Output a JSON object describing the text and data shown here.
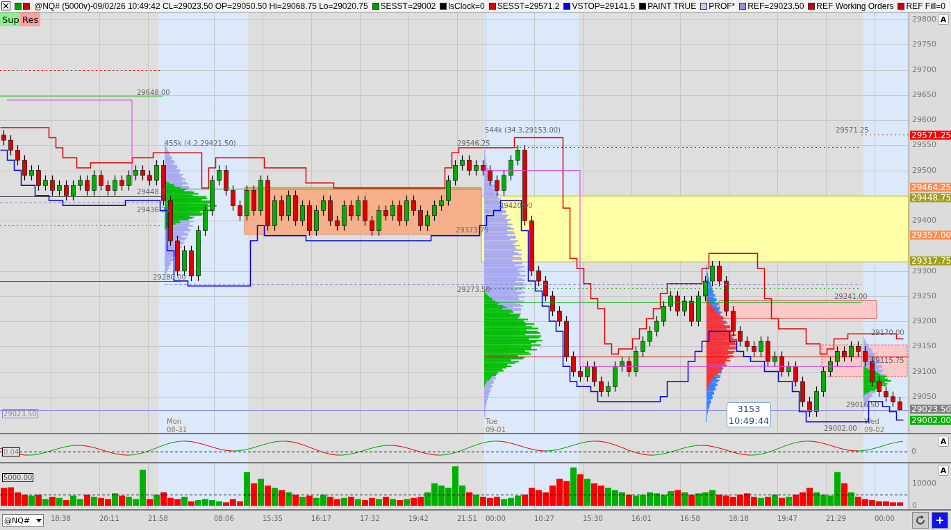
{
  "header": {
    "title": "@NQ# (5000v)-09/02/26 10:49:42 CL=29023.50 OP=29050.50 Hi=29068.75 Lo=29020.75",
    "legend": [
      {
        "text": "SESST=29002",
        "color": "#00a000"
      },
      {
        "text": "lsClock=0",
        "color": "#000000"
      },
      {
        "text": "SESST=29571.2",
        "color": "#e00000"
      },
      {
        "text": "VSTOP=29141.5",
        "color": "#0000e0"
      },
      {
        "text": "PAINT TRUE",
        "color": "#000000"
      },
      {
        "text": "PROF*",
        "color": "#c8c8f0"
      },
      {
        "text": "REF=29023.50",
        "color": "#9090e0"
      },
      {
        "text": "REF Working Orders",
        "color": "#d00000"
      },
      {
        "text": "REF Fill=0",
        "color": "#d00000"
      }
    ]
  },
  "buttons": [
    {
      "label": "Sup",
      "kind": "support"
    },
    {
      "label": "Res",
      "kind": "resistance"
    }
  ],
  "price_chart": {
    "autoscale": "A",
    "chart_data": {
      "type": "candlestick",
      "grid": true,
      "ylim": [
        28978,
        29814
      ],
      "yticks": [
        29050,
        29100,
        29150,
        29200,
        29250,
        29300,
        29400,
        29500,
        29550,
        29600,
        29650,
        29700,
        29750,
        29800
      ],
      "ohlc": [
        [
          29570,
          29580,
          29550,
          29560
        ],
        [
          29560,
          29570,
          29530,
          29540
        ],
        [
          29540,
          29550,
          29510,
          29520
        ],
        [
          29520,
          29530,
          29480,
          29490
        ],
        [
          29490,
          29510,
          29480,
          29500
        ],
        [
          29500,
          29510,
          29460,
          29470
        ],
        [
          29470,
          29490,
          29460,
          29480
        ],
        [
          29480,
          29490,
          29450,
          29460
        ],
        [
          29460,
          29480,
          29450,
          29470
        ],
        [
          29470,
          29480,
          29440,
          29450
        ],
        [
          29450,
          29480,
          29440,
          29470
        ],
        [
          29470,
          29490,
          29460,
          29480
        ],
        [
          29480,
          29490,
          29450,
          29460
        ],
        [
          29460,
          29500,
          29450,
          29490
        ],
        [
          29490,
          29500,
          29460,
          29470
        ],
        [
          29470,
          29480,
          29450,
          29460
        ],
        [
          29460,
          29490,
          29450,
          29480
        ],
        [
          29480,
          29490,
          29460,
          29470
        ],
        [
          29470,
          29500,
          29460,
          29490
        ],
        [
          29490,
          29510,
          29480,
          29500
        ],
        [
          29500,
          29510,
          29480,
          29490
        ],
        [
          29490,
          29500,
          29470,
          29480
        ],
        [
          29480,
          29520,
          29470,
          29510
        ],
        [
          29510,
          29520,
          29430,
          29440
        ],
        [
          29440,
          29450,
          29350,
          29360
        ],
        [
          29360,
          29370,
          29290,
          29300
        ],
        [
          29300,
          29350,
          29290,
          29340
        ],
        [
          29340,
          29350,
          29280,
          29290
        ],
        [
          29290,
          29390,
          29280,
          29380
        ],
        [
          29380,
          29430,
          29370,
          29420
        ],
        [
          29420,
          29490,
          29410,
          29480
        ],
        [
          29480,
          29510,
          29470,
          29500
        ],
        [
          29500,
          29510,
          29450,
          29460
        ],
        [
          29460,
          29470,
          29420,
          29430
        ],
        [
          29430,
          29440,
          29400,
          29410
        ],
        [
          29410,
          29470,
          29400,
          29460
        ],
        [
          29460,
          29470,
          29410,
          29420
        ],
        [
          29420,
          29490,
          29410,
          29480
        ],
        [
          29480,
          29490,
          29380,
          29390
        ],
        [
          29390,
          29450,
          29380,
          29440
        ],
        [
          29440,
          29450,
          29400,
          29410
        ],
        [
          29410,
          29460,
          29400,
          29450
        ],
        [
          29450,
          29460,
          29390,
          29400
        ],
        [
          29400,
          29440,
          29390,
          29430
        ],
        [
          29430,
          29440,
          29370,
          29380
        ],
        [
          29380,
          29430,
          29370,
          29420
        ],
        [
          29420,
          29450,
          29410,
          29440
        ],
        [
          29440,
          29450,
          29390,
          29400
        ],
        [
          29400,
          29410,
          29380,
          29390
        ],
        [
          29390,
          29440,
          29380,
          29430
        ],
        [
          29430,
          29440,
          29400,
          29410
        ],
        [
          29410,
          29450,
          29400,
          29440
        ],
        [
          29440,
          29450,
          29390,
          29400
        ],
        [
          29400,
          29410,
          29370,
          29380
        ],
        [
          29380,
          29430,
          29370,
          29420
        ],
        [
          29420,
          29430,
          29400,
          29410
        ],
        [
          29410,
          29440,
          29400,
          29430
        ],
        [
          29430,
          29440,
          29390,
          29400
        ],
        [
          29400,
          29450,
          29390,
          29440
        ],
        [
          29440,
          29450,
          29410,
          29420
        ],
        [
          29420,
          29430,
          29380,
          29390
        ],
        [
          29390,
          29420,
          29380,
          29410
        ],
        [
          29410,
          29440,
          29400,
          29430
        ],
        [
          29430,
          29450,
          29420,
          29440
        ],
        [
          29440,
          29490,
          29430,
          29480
        ],
        [
          29480,
          29520,
          29470,
          29510
        ],
        [
          29510,
          29530,
          29500,
          29520
        ],
        [
          29520,
          29530,
          29490,
          29500
        ],
        [
          29500,
          29520,
          29490,
          29510
        ],
        [
          29510,
          29520,
          29490,
          29500
        ],
        [
          29500,
          29510,
          29470,
          29480
        ],
        [
          29480,
          29490,
          29450,
          29460
        ],
        [
          29460,
          29500,
          29450,
          29490
        ],
        [
          29490,
          29530,
          29480,
          29520
        ],
        [
          29520,
          29550,
          29510,
          29540
        ],
        [
          29540,
          29550,
          29390,
          29400
        ],
        [
          29400,
          29410,
          29290,
          29300
        ],
        [
          29300,
          29310,
          29270,
          29280
        ],
        [
          29280,
          29290,
          29240,
          29250
        ],
        [
          29250,
          29260,
          29210,
          29220
        ],
        [
          29220,
          29230,
          29190,
          29200
        ],
        [
          29200,
          29210,
          29120,
          29130
        ],
        [
          29130,
          29140,
          29090,
          29100
        ],
        [
          29100,
          29110,
          29080,
          29090
        ],
        [
          29090,
          29120,
          29080,
          29110
        ],
        [
          29110,
          29120,
          29070,
          29080
        ],
        [
          29080,
          29090,
          29050,
          29060
        ],
        [
          29060,
          29080,
          29050,
          29070
        ],
        [
          29070,
          29120,
          29060,
          29110
        ],
        [
          29110,
          29130,
          29100,
          29120
        ],
        [
          29120,
          29130,
          29090,
          29100
        ],
        [
          29100,
          29150,
          29090,
          29140
        ],
        [
          29140,
          29170,
          29130,
          29160
        ],
        [
          29160,
          29190,
          29150,
          29180
        ],
        [
          29180,
          29210,
          29170,
          29200
        ],
        [
          29200,
          29240,
          29190,
          29230
        ],
        [
          29230,
          29260,
          29220,
          29250
        ],
        [
          29250,
          29260,
          29210,
          29220
        ],
        [
          29220,
          29250,
          29210,
          29240
        ],
        [
          29240,
          29250,
          29190,
          29200
        ],
        [
          29200,
          29260,
          29190,
          29250
        ],
        [
          29250,
          29290,
          29240,
          29280
        ],
        [
          29280,
          29320,
          29270,
          29310
        ],
        [
          29310,
          29320,
          29270,
          29280
        ],
        [
          29280,
          29290,
          29210,
          29220
        ],
        [
          29220,
          29230,
          29170,
          29180
        ],
        [
          29180,
          29190,
          29150,
          29160
        ],
        [
          29160,
          29170,
          29140,
          29150
        ],
        [
          29150,
          29160,
          29130,
          29140
        ],
        [
          29140,
          29170,
          29130,
          29160
        ],
        [
          29160,
          29170,
          29110,
          29120
        ],
        [
          29120,
          29140,
          29110,
          29130
        ],
        [
          29130,
          29140,
          29090,
          29100
        ],
        [
          29100,
          29120,
          29090,
          29110
        ],
        [
          29110,
          29120,
          29070,
          29080
        ],
        [
          29080,
          29090,
          29030,
          29040
        ],
        [
          29040,
          29050,
          29010,
          29020
        ],
        [
          29020,
          29070,
          29010,
          29060
        ],
        [
          29060,
          29110,
          29050,
          29100
        ],
        [
          29100,
          29130,
          29090,
          29120
        ],
        [
          29120,
          29150,
          29110,
          29140
        ],
        [
          29140,
          29150,
          29120,
          29130
        ],
        [
          29130,
          29160,
          29120,
          29150
        ],
        [
          29150,
          29160,
          29130,
          29140
        ],
        [
          29140,
          29150,
          29110,
          29120
        ],
        [
          29120,
          29130,
          29070,
          29080
        ],
        [
          29080,
          29090,
          29050,
          29060
        ],
        [
          29060,
          29070,
          29040,
          29050
        ],
        [
          29050,
          29060,
          29030,
          29040
        ],
        [
          29040,
          29050,
          29020.75,
          29023.5
        ]
      ]
    },
    "price_tags": [
      {
        "text": "29571.25",
        "color": "#ff0000"
      },
      {
        "text": "29464.25",
        "color": "#ff8c50"
      },
      {
        "text": "29448.75",
        "color": "#a0a020"
      },
      {
        "text": "29357.00",
        "color": "#ff8c50"
      },
      {
        "text": "29317.75",
        "color": "#a0a020"
      },
      {
        "text": "29023.50",
        "color": "#808080"
      },
      {
        "text": "29002.00",
        "color": "#00b000"
      }
    ],
    "labels": [
      "29648.00",
      "455k (4.2,29421.50)",
      "29448.25",
      "29436.25",
      "29280.00",
      "29546.25",
      "29373.75",
      "29273.50",
      "544k (34.3,29153.00)",
      "29420.00",
      "29571.25",
      "29241.00",
      "29170.00",
      "29115.75",
      "29016.50",
      "29002.00"
    ],
    "ref_box": "29023.50",
    "days": [
      {
        "name": "Mon",
        "date": "08-31"
      },
      {
        "name": "Tue",
        "date": "09-01"
      },
      {
        "name": "Wed",
        "date": "09-02"
      }
    ],
    "cursor_box": {
      "volume": "3153",
      "time": "10:49:44"
    }
  },
  "oscillator": {
    "autoscale": "A",
    "value_box": "0.04",
    "axis_label": "0"
  },
  "volume_chart": {
    "autoscale": "A",
    "threshold_box": "5000.00",
    "chart_data": {
      "type": "bar",
      "grid": true,
      "ylim": [
        -1500,
        18800
      ],
      "yticks": [
        0,
        10000
      ],
      "series": [
        {
          "color": "#00b000",
          "values": [
            null,
            null,
            null,
            null,
            4500,
            null,
            3000,
            null,
            3500,
            null,
            4500,
            3000,
            null,
            4000,
            null,
            null,
            5500,
            null,
            4000,
            3000,
            16000,
            null,
            5000,
            null,
            null,
            null,
            4000,
            null,
            2500,
            3000,
            2500,
            2000,
            null,
            null,
            null,
            15000,
            null,
            12000,
            null,
            8000,
            null,
            6000,
            null,
            4000,
            null,
            3500,
            5000,
            null,
            null,
            3500,
            null,
            3000,
            null,
            null,
            3000,
            null,
            3000,
            null,
            3000,
            null,
            null,
            6000,
            10000,
            9000,
            8000,
            17500,
            9000,
            null,
            5000,
            null,
            null,
            null,
            3000,
            3500,
            4500,
            null,
            null,
            null,
            null,
            null,
            null,
            null,
            17000,
            null,
            12000,
            null,
            null,
            8000,
            7000,
            6000,
            null,
            4500,
            5000,
            6000,
            5500,
            5000,
            6500,
            null,
            6000,
            null,
            5500,
            6000,
            7000,
            null,
            null,
            null,
            null,
            null,
            null,
            3500,
            null,
            5000,
            null,
            4000,
            null,
            null,
            null,
            6000,
            5000,
            4500,
            15000,
            null,
            6000,
            null,
            null,
            null,
            null,
            null,
            null,
            null
          ]
        },
        {
          "color": "#ff0000",
          "values": [
            8000,
            8200,
            6000,
            5000,
            null,
            5000,
            null,
            4000,
            null,
            2500,
            null,
            null,
            5000,
            null,
            3500,
            3000,
            null,
            4500,
            null,
            null,
            null,
            3000,
            null,
            6000,
            3500,
            3000,
            null,
            2000,
            null,
            null,
            null,
            null,
            1500,
            3000,
            2000,
            null,
            10000,
            null,
            9000,
            null,
            7000,
            null,
            5000,
            null,
            4500,
            null,
            null,
            4000,
            3000,
            null,
            4000,
            null,
            2500,
            3500,
            null,
            4000,
            null,
            2500,
            null,
            3500,
            4000,
            null,
            null,
            null,
            null,
            null,
            null,
            6000,
            null,
            4000,
            3500,
            4000,
            null,
            null,
            null,
            5000,
            8000,
            7000,
            6000,
            9000,
            12000,
            11000,
            null,
            14000,
            null,
            10000,
            9000,
            null,
            null,
            null,
            5000,
            null,
            null,
            null,
            null,
            null,
            null,
            7000,
            null,
            5000,
            null,
            null,
            null,
            5000,
            4500,
            4000,
            5000,
            5500,
            4000,
            null,
            4000,
            null,
            3500,
            null,
            5000,
            6000,
            8000,
            null,
            null,
            null,
            null,
            10000,
            null,
            4000,
            3000,
            2500,
            2000,
            2000,
            1500,
            1500
          ]
        }
      ]
    }
  },
  "time_axis": [
    "18:38",
    "20:11",
    "21:58",
    "08:06",
    "15:35",
    "16:17",
    "17:32",
    "19:42",
    "21:51",
    "00:00",
    "10:27",
    "15:30",
    "16:01",
    "16:58",
    "18:18",
    "19:47",
    "21:29",
    "00:00"
  ],
  "symbol": "@NQ#"
}
